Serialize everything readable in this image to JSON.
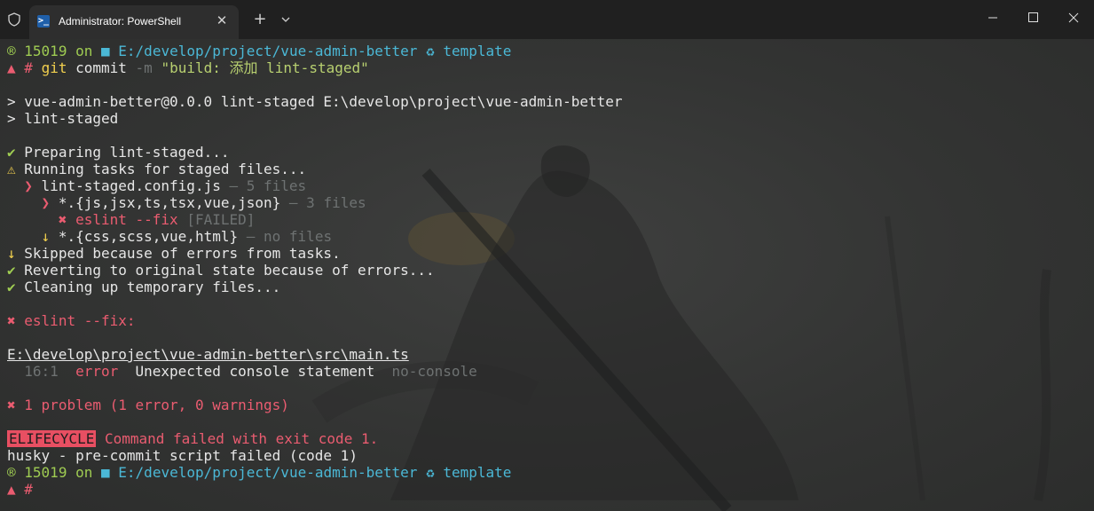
{
  "window": {
    "tab_title": "Administrator: PowerShell",
    "tab_icon_glyph": ">_",
    "close_tab_glyph": "✕",
    "new_tab_glyph": "+"
  },
  "colors": {
    "background": "#333433",
    "green": "#9fcc52",
    "cyan": "#4bb8d6",
    "red": "#ea5c70",
    "yellow": "#f2d04e",
    "dim": "#6e7272",
    "text": "#e6e6e6"
  },
  "terminal": {
    "prompt1": {
      "status_icon": "®",
      "pid": "15019",
      "on": "on",
      "folder_icon": "■",
      "path": "E:/develop/project/vue-admin-better",
      "git_icon": "♻",
      "branch": "template"
    },
    "command": {
      "symbol": "▲",
      "hash": "#",
      "cmd": "git",
      "sub": "commit",
      "flag": "-m",
      "message": "\"build: 添加 lint-staged\""
    },
    "npm_line1": "> vue-admin-better@0.0.0 lint-staged E:\\develop\\project\\vue-admin-better",
    "npm_line2": "> lint-staged",
    "tasks": {
      "preparing": {
        "icon": "✔",
        "text": "Preparing lint-staged..."
      },
      "running": {
        "icon": "⚠",
        "text": "Running tasks for staged files..."
      },
      "config": {
        "icon": "❯",
        "text": "lint-staged.config.js",
        "meta": "— 5 files"
      },
      "group1": {
        "icon": "❯",
        "text": "*.{js,jsx,ts,tsx,vue,json}",
        "meta": "— 3 files"
      },
      "eslint": {
        "icon": "✖",
        "text": "eslint --fix",
        "meta": "[FAILED]"
      },
      "group2": {
        "icon": "↓",
        "text": "*.{css,scss,vue,html}",
        "meta": "— no files"
      },
      "skipped": {
        "icon": "↓",
        "text": "Skipped because of errors from tasks."
      },
      "reverting": {
        "icon": "✔",
        "text": "Reverting to original state because of errors..."
      },
      "cleaning": {
        "icon": "✔",
        "text": "Cleaning up temporary files..."
      }
    },
    "eslint_header": {
      "icon": "✖",
      "text": "eslint --fix:"
    },
    "file_path": "E:\\develop\\project\\vue-admin-better\\src\\main.ts",
    "lint_error": {
      "location": "16:1",
      "level": "error",
      "message": "Unexpected console statement",
      "rule": "no-console"
    },
    "summary": {
      "icon": "✖",
      "text": "1 problem (1 error, 0 warnings)"
    },
    "lifecycle": {
      "badge": "ELIFECYCLE",
      "text": "Command failed with exit code 1."
    },
    "husky": "husky - pre-commit script failed (code 1)",
    "prompt2": {
      "status_icon": "®",
      "pid": "15019",
      "on": "on",
      "folder_icon": "■",
      "path": "E:/develop/project/vue-admin-better",
      "git_icon": "♻",
      "branch": "template"
    },
    "final_prompt": {
      "symbol": "▲",
      "hash": "#"
    }
  }
}
